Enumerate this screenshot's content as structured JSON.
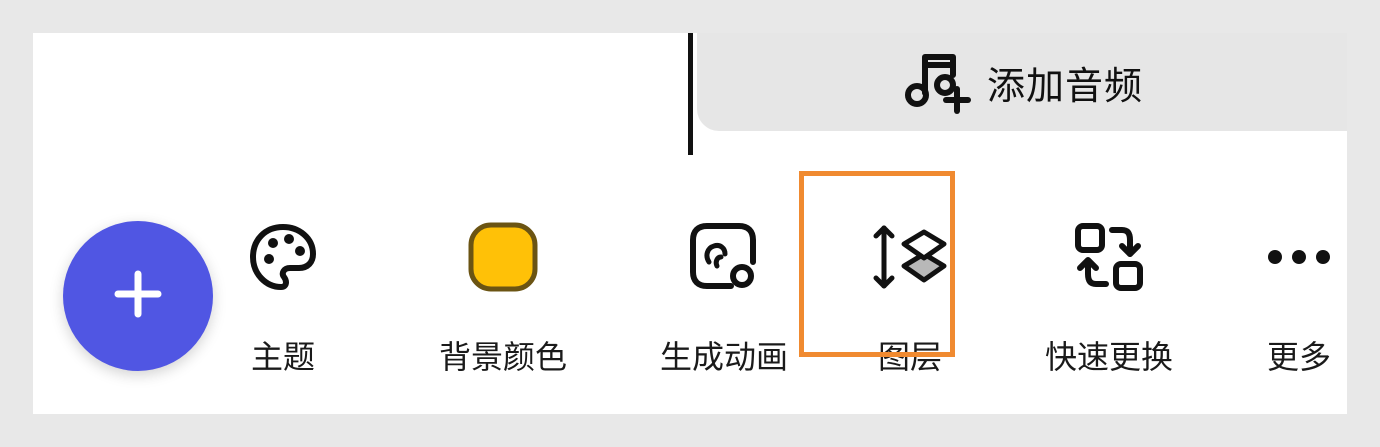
{
  "audio": {
    "label": "添加音频",
    "icon": "music-note-add-icon"
  },
  "fab": {
    "icon": "plus-icon",
    "color": "#5056e3"
  },
  "toolbar": {
    "items": [
      {
        "id": "theme",
        "label": "主题",
        "icon": "palette-icon"
      },
      {
        "id": "background-color",
        "label": "背景颜色",
        "icon": "color-swatch-icon",
        "swatch_color": "#ffc107"
      },
      {
        "id": "generate-animation",
        "label": "生成动画",
        "icon": "animation-icon"
      },
      {
        "id": "layers",
        "label": "图层",
        "icon": "layers-icon",
        "highlighted": true
      },
      {
        "id": "quick-replace",
        "label": "快速更换",
        "icon": "swap-icon"
      },
      {
        "id": "more",
        "label": "更多",
        "icon": "more-dots-icon"
      }
    ]
  },
  "highlight_color": "#f08a30"
}
